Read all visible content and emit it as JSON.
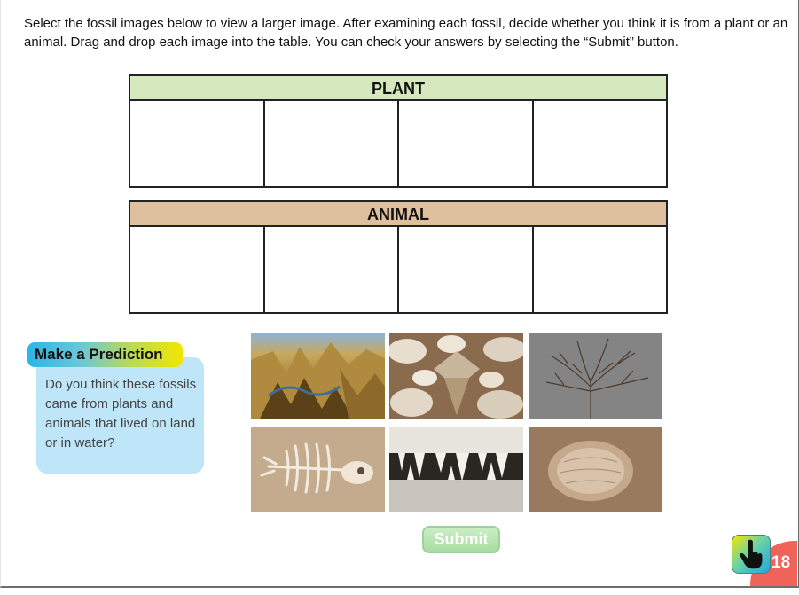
{
  "instructions": "Select the fossil images below to view a larger image. After examining each fossil, decide whether you think it is from a plant or an animal. Drag and drop each image into the table. You can check your answers by selecting the “Submit” button.",
  "tables": {
    "plant": {
      "header": "PLANT",
      "slots": 4
    },
    "animal": {
      "header": "ANIMAL",
      "slots": 4
    }
  },
  "prediction": {
    "title": "Make a Prediction",
    "question": "Do you think these fossils came from plants and animals that lived on land or in water?"
  },
  "fossils": [
    {
      "id": "fossil-1",
      "icon": "rock-formation-fossil"
    },
    {
      "id": "fossil-2",
      "icon": "shark-teeth-fossil"
    },
    {
      "id": "fossil-3",
      "icon": "fern-leaf-fossil"
    },
    {
      "id": "fossil-4",
      "icon": "turtle-skeleton-fossil"
    },
    {
      "id": "fossil-5",
      "icon": "jaw-teeth-fossil"
    },
    {
      "id": "fossil-6",
      "icon": "shell-imprint-fossil"
    }
  ],
  "submit_label": "Submit",
  "page_number": "18",
  "colors": {
    "plant_header": "#d6e8bd",
    "animal_header": "#dfc09e",
    "prediction_box": "#bfe6f8",
    "submit": "#a8dca3",
    "page_corner": "#f0635a"
  }
}
